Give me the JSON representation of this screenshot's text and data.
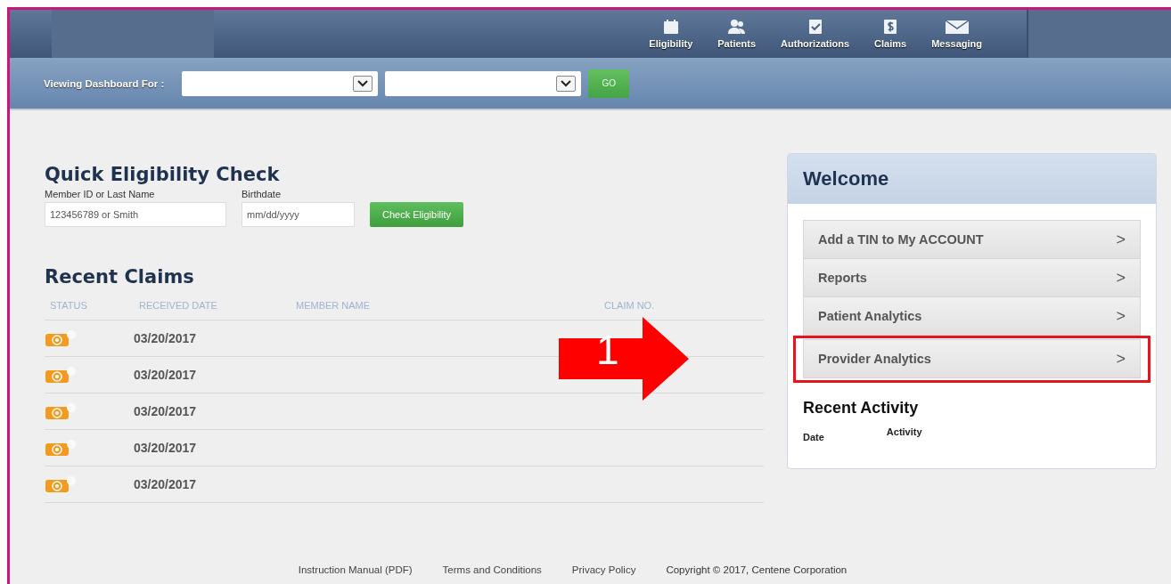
{
  "nav": [
    {
      "label": "Eligibility",
      "kind": "calendar"
    },
    {
      "label": "Patients",
      "kind": "people"
    },
    {
      "label": "Authorizations",
      "kind": "check"
    },
    {
      "label": "Claims",
      "kind": "dollar"
    },
    {
      "label": "Messaging",
      "kind": "mail"
    }
  ],
  "filter": {
    "label": "Viewing Dashboard For :",
    "go": "GO"
  },
  "quick_check": {
    "title": "Quick Eligibility Check",
    "fields": [
      {
        "label": "Member ID or Last Name",
        "placeholder": "123456789 or Smith",
        "kind": "wide"
      },
      {
        "label": "Birthdate",
        "placeholder": "mm/dd/yyyy",
        "kind": "narrow"
      }
    ],
    "button": "Check Eligibility"
  },
  "recent_claims": {
    "title": "Recent Claims",
    "columns": [
      "STATUS",
      "RECEIVED DATE",
      "MEMBER NAME",
      "CLAIM NO."
    ],
    "rows": [
      {
        "date": "03/20/2017"
      },
      {
        "date": "03/20/2017"
      },
      {
        "date": "03/20/2017"
      },
      {
        "date": "03/20/2017"
      },
      {
        "date": "03/20/2017"
      }
    ]
  },
  "annotation": {
    "label": "1"
  },
  "welcome": {
    "title": "Welcome",
    "items": [
      {
        "label": "Add a TIN to My ACCOUNT",
        "chevron": ">",
        "highlighted": false
      },
      {
        "label": "Reports",
        "chevron": ">",
        "highlighted": false
      },
      {
        "label": "Patient Analytics",
        "chevron": ">",
        "highlighted": false
      },
      {
        "label": "Provider Analytics",
        "chevron": ">",
        "highlighted": true
      }
    ],
    "activity_title": "Recent Activity",
    "activity_columns": [
      "Date",
      "Activity"
    ]
  },
  "footer": [
    "Instruction Manual (PDF)",
    "Terms and Conditions",
    "Privacy Policy",
    "Copyright © 2017, Centene Corporation"
  ]
}
